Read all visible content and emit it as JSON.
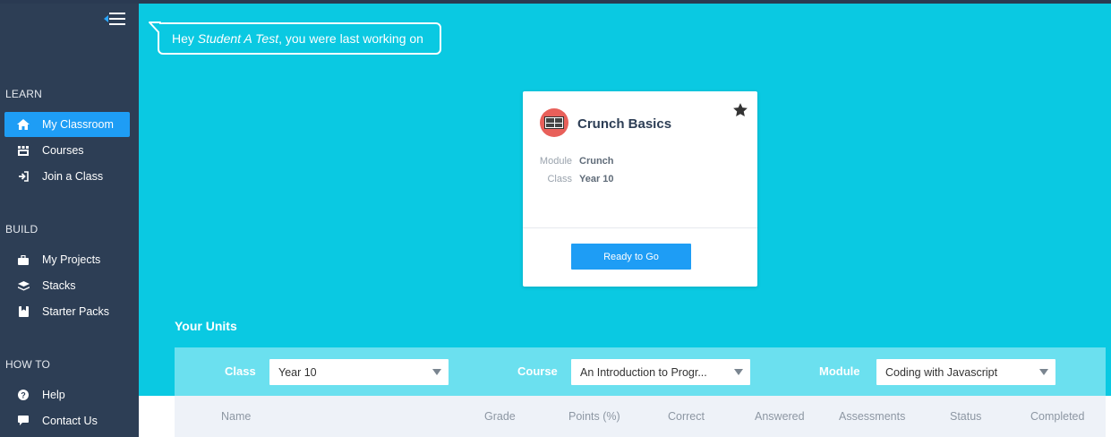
{
  "sidebar": {
    "sections": [
      {
        "title": "LEARN",
        "items": [
          {
            "label": "My Classroom",
            "icon": "home-icon",
            "active": true
          },
          {
            "label": "Courses",
            "icon": "courses-icon"
          },
          {
            "label": "Join a Class",
            "icon": "sign-in-icon"
          }
        ]
      },
      {
        "title": "BUILD",
        "items": [
          {
            "label": "My Projects",
            "icon": "briefcase-icon"
          },
          {
            "label": "Stacks",
            "icon": "layers-icon"
          },
          {
            "label": "Starter Packs",
            "icon": "package-icon"
          }
        ]
      },
      {
        "title": "HOW TO",
        "items": [
          {
            "label": "Help",
            "icon": "question-circle-icon"
          },
          {
            "label": "Contact Us",
            "icon": "chat-icon"
          }
        ]
      }
    ]
  },
  "greeting": {
    "prefix": "Hey ",
    "name": "Student A Test",
    "suffix": ", you were last working on"
  },
  "card": {
    "title": "Crunch Basics",
    "module_label": "Module",
    "module_value": "Crunch",
    "class_label": "Class",
    "class_value": "Year 10",
    "button_label": "Ready to Go"
  },
  "units": {
    "title": "Your Units",
    "filters": {
      "class_label": "Class",
      "class_value": "Year 10",
      "course_label": "Course",
      "course_value": "An Introduction to Progr...",
      "module_label": "Module",
      "module_value": "Coding with Javascript"
    },
    "columns": [
      "Name",
      "Grade",
      "Points (%)",
      "Correct",
      "Answered",
      "Assessments",
      "Status",
      "Completed"
    ]
  },
  "colors": {
    "accent": "#1e9df5",
    "background": "#0ac9e2",
    "sidebar": "#2d3e55",
    "filter_bar": "#6be0ef"
  }
}
